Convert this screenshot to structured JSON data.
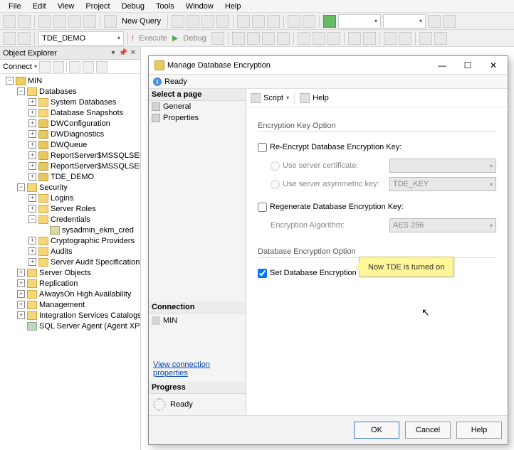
{
  "menu": {
    "items": [
      "File",
      "Edit",
      "View",
      "Project",
      "Debug",
      "Tools",
      "Window",
      "Help"
    ]
  },
  "toolbar1": {
    "new_query": "New Query"
  },
  "toolbar2": {
    "db": "TDE_DEMO",
    "execute": "Execute",
    "debug": "Debug"
  },
  "explorer": {
    "title": "Object Explorer",
    "connect": "Connect",
    "nodes": {
      "server": "MIN",
      "databases": "Databases",
      "sysdb": "System Databases",
      "snap": "Database Snapshots",
      "dwconfig": "DWConfiguration",
      "dwdiag": "DWDiagnostics",
      "dwqueue": "DWQueue",
      "rs1": "ReportServer$MSSQLSERVER",
      "rs2": "ReportServer$MSSQLSERVER",
      "tdedemo": "TDE_DEMO",
      "security": "Security",
      "logins": "Logins",
      "serverroles": "Server Roles",
      "credentials": "Credentials",
      "sysadmin": "sysadmin_ekm_cred",
      "crypto": "Cryptographic Providers",
      "audits": "Audits",
      "audit_specs": "Server Audit Specifications",
      "server_objects": "Server Objects",
      "replication": "Replication",
      "alwayson": "AlwaysOn High Availability",
      "management": "Management",
      "isc": "Integration Services Catalogs",
      "agent": "SQL Server Agent (Agent XPs disabl"
    }
  },
  "dialog": {
    "title": "Manage Database Encryption",
    "ready": "Ready",
    "select_page": "Select a page",
    "general": "General",
    "properties": "Properties",
    "connection": "Connection",
    "conn_name": "MIN",
    "view_conn": "View connection properties",
    "progress_hdr": "Progress",
    "progress": "Ready",
    "script": "Script",
    "help": "Help",
    "section1": "Encryption Key Option",
    "reencrypt": "Re-Encrypt Database Encryption Key:",
    "use_cert": "Use server certificate:",
    "use_asym": "Use server asymmetric key:",
    "asym_val": "TDE_KEY",
    "regen": "Regenerate Database Encryption Key:",
    "algo": "Encryption Algorithm:",
    "algo_val": "AES 256",
    "section2": "Database Encryption Option",
    "set_on": "Set Database Encryption On",
    "callout": "Now TDE is turned on",
    "ok": "OK",
    "cancel": "Cancel",
    "help_btn": "Help"
  }
}
